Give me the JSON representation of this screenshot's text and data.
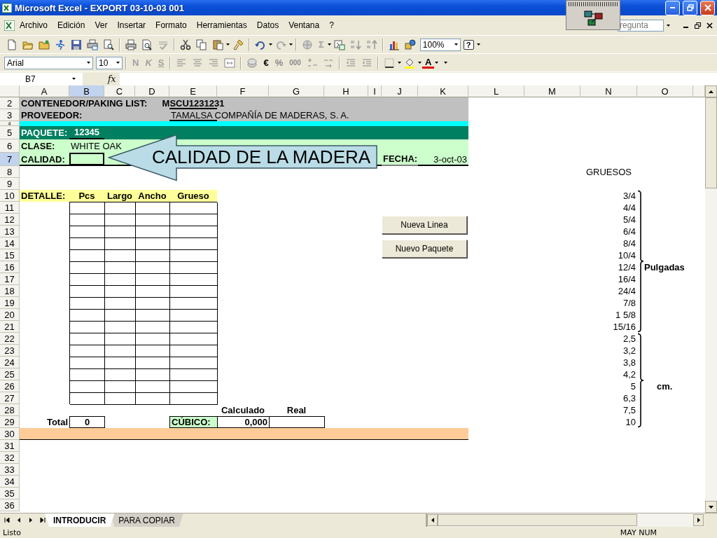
{
  "window": {
    "title": "Microsoft Excel - EXPORT 03-10-03 001"
  },
  "menu_bar": {
    "items": [
      "Archivo",
      "Edición",
      "Ver",
      "Insertar",
      "Formato",
      "Herramientas",
      "Datos",
      "Ventana",
      "?"
    ],
    "help_box": {
      "placeholder": "regunta"
    }
  },
  "standard_toolbar": {
    "sum": {
      "label": "Σ",
      "disabled": true
    },
    "zoom": "100%",
    "help": "?"
  },
  "format_toolbar": {
    "font": "Arial",
    "size": "10",
    "bold": {
      "label": "N",
      "disabled": true
    },
    "italic": {
      "label": "K",
      "disabled": true
    },
    "underline": {
      "label": "S",
      "disabled": true
    },
    "currency": "€",
    "percent": "%",
    "thousands": "000",
    "font_color": "A"
  },
  "formula_bar": {
    "name_box": "B7",
    "fx": "fx"
  },
  "columns": [
    {
      "label": "A",
      "selected": false
    },
    {
      "label": "B",
      "selected": true
    },
    {
      "label": "C",
      "selected": false
    },
    {
      "label": "D",
      "selected": false
    },
    {
      "label": "E",
      "selected": false
    },
    {
      "label": "F",
      "selected": false
    },
    {
      "label": "G",
      "selected": false
    },
    {
      "label": "H",
      "selected": false
    },
    {
      "label": "I",
      "selected": false
    },
    {
      "label": "J",
      "selected": false
    },
    {
      "label": "K",
      "selected": false
    },
    {
      "label": "L",
      "selected": false
    },
    {
      "label": "M",
      "selected": false
    },
    {
      "label": "N",
      "selected": false
    },
    {
      "label": "O",
      "selected": false
    }
  ],
  "rows": [
    {
      "label": "2",
      "selected": false
    },
    {
      "label": "3",
      "selected": false
    },
    {
      "label": "4",
      "selected": false
    },
    {
      "label": "5",
      "selected": false
    },
    {
      "label": "6",
      "selected": false
    },
    {
      "label": "7",
      "selected": true
    },
    {
      "label": "8",
      "selected": false
    },
    {
      "label": "9",
      "selected": false
    },
    {
      "label": "10",
      "selected": false
    },
    {
      "label": "11",
      "selected": false
    },
    {
      "label": "12",
      "selected": false
    },
    {
      "label": "13",
      "selected": false
    },
    {
      "label": "14",
      "selected": false
    },
    {
      "label": "15",
      "selected": false
    },
    {
      "label": "16",
      "selected": false
    },
    {
      "label": "17",
      "selected": false
    },
    {
      "label": "18",
      "selected": false
    },
    {
      "label": "19",
      "selected": false
    },
    {
      "label": "20",
      "selected": false
    },
    {
      "label": "21",
      "selected": false
    },
    {
      "label": "22",
      "selected": false
    },
    {
      "label": "23",
      "selected": false
    },
    {
      "label": "24",
      "selected": false
    },
    {
      "label": "25",
      "selected": false
    },
    {
      "label": "26",
      "selected": false
    },
    {
      "label": "27",
      "selected": false
    },
    {
      "label": "28",
      "selected": false
    },
    {
      "label": "29",
      "selected": false
    },
    {
      "label": "30",
      "selected": false
    },
    {
      "label": "31",
      "selected": false
    },
    {
      "label": "32",
      "selected": false
    },
    {
      "label": "33",
      "selected": false
    },
    {
      "label": "34",
      "selected": false
    },
    {
      "label": "35",
      "selected": false
    },
    {
      "label": "36",
      "selected": false
    }
  ],
  "header_block": {
    "container_label": "CONTENEDOR/PAKING LIST:",
    "container": "MSCU1231231",
    "supplier_label": "PROVEEDOR:",
    "supplier": "TAMALSA COMPAÑÍA DE MADERAS, S. A.",
    "package_label": "PAQUETE:",
    "package": "12345",
    "class_label": "CLASE:",
    "class": "WHITE OAK",
    "quality_label": "CALIDAD:",
    "date_label": "FECHA:",
    "date": "3-oct-03"
  },
  "callout": {
    "text": "CALIDAD DE LA MADERA"
  },
  "detail_table": {
    "title": "DETALLE:",
    "columns": [
      "Pcs",
      "Largo",
      "Ancho",
      "Grueso"
    ]
  },
  "totals": {
    "total_label": "Total",
    "total": "0",
    "calculated_header": "Calculado",
    "real_header": "Real",
    "cubic_label": "CÚBICO:",
    "calculated": "0,000"
  },
  "buttons": [
    "Nueva Linea",
    "Nuevo Paquete"
  ],
  "thickness": {
    "title": "GRUESOS",
    "inches": [
      "3/4",
      "4/4",
      "5/4",
      "6/4",
      "8/4",
      "10/4",
      "12/4",
      "16/4",
      "24/4",
      "7/8",
      "1 5/8",
      "15/16"
    ],
    "inches_label": "Pulgadas",
    "cm": [
      "2,5",
      "3,2",
      "3,8",
      "4,2",
      "5",
      "6,3",
      "7,5",
      "10"
    ],
    "cm_label": "cm."
  },
  "sheet_tabs": [
    {
      "label": "INTRODUCIR",
      "selected": true
    },
    {
      "label": "PARA COPIAR",
      "selected": false
    }
  ],
  "status_bar": {
    "text": "Listo",
    "indicators": "MAY NUM"
  }
}
